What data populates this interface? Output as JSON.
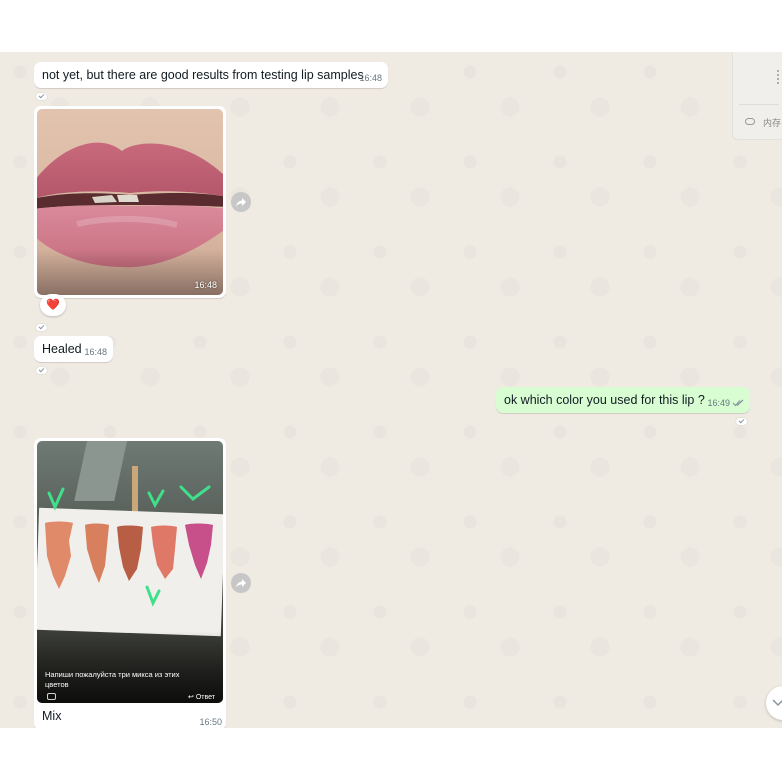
{
  "messages": {
    "m1": {
      "text": "not yet, but there are good results from testing lip samples",
      "time": "16:48"
    },
    "m2": {
      "time": "16:48",
      "reaction": "❤️"
    },
    "m3": {
      "text": "Healed",
      "time": "16:48"
    },
    "m4": {
      "text": "ok  which color you used for this lip ?",
      "time": "16:49"
    },
    "m5": {
      "caption": "Mix",
      "time": "16:50",
      "inner_caption": "Напиши пожалуйста три микса из этих цветов",
      "inner_reply": "Ответ"
    }
  },
  "side_panel": {
    "label": "内存"
  },
  "colors": {
    "chat_bg": "#efeae2",
    "incoming": "#ffffff",
    "outgoing": "#d9fdd3",
    "check_read": "#53bdeb"
  },
  "icons": {
    "forward": "forward-icon",
    "check": "double-check-icon",
    "scroll": "chevron-down-icon"
  }
}
